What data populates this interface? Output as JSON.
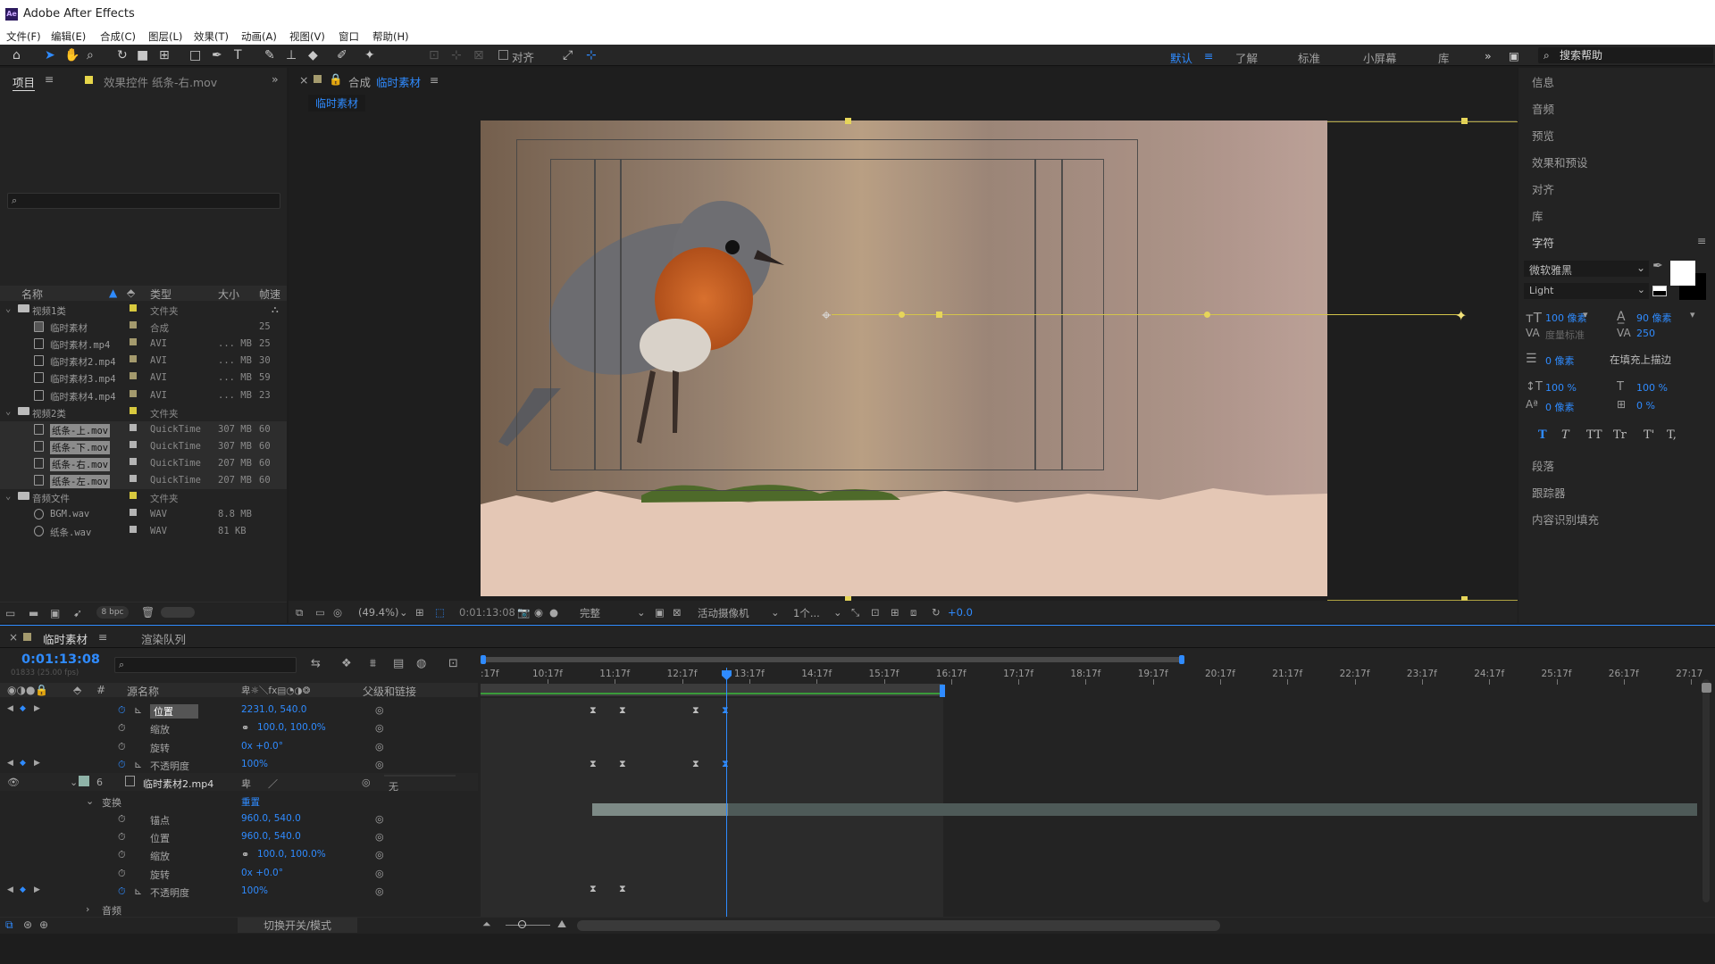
{
  "app": {
    "logo": "Ae",
    "title": "Adobe After Effects"
  },
  "menu": [
    "文件(F)",
    "编辑(E)",
    "合成(C)",
    "图层(L)",
    "效果(T)",
    "动画(A)",
    "视图(V)",
    "窗口",
    "帮助(H)"
  ],
  "toolbar": {
    "tools": [
      "home-icon",
      "selection-icon",
      "hand-icon",
      "zoom-icon",
      "rotate-icon",
      "camera-icon",
      "pan-behind-icon",
      "rectangle-icon",
      "pen-icon",
      "text-icon",
      "brush-icon",
      "clone-stamp-icon",
      "eraser-icon",
      "roto-brush-icon",
      "puppet-pin-icon"
    ],
    "align_label": "对齐",
    "workspaces": [
      "默认",
      "了解",
      "标准",
      "小屏幕",
      "库"
    ],
    "search_help": "搜索帮助"
  },
  "project": {
    "tab_project": "项目",
    "tab_effects": "效果控件 纸条-右.mov",
    "search_placeholder": "",
    "columns": {
      "name": "名称",
      "type": "类型",
      "size": "大小",
      "fps": "帧速"
    },
    "items": [
      {
        "name": "视频1类",
        "type": "文件夹",
        "size": "",
        "fps": "",
        "kind": "folder",
        "color": "#d8c93e",
        "indent": 0,
        "selected": false
      },
      {
        "name": "临时素材",
        "type": "合成",
        "size": "",
        "fps": "25",
        "kind": "comp",
        "color": "#a49a6d",
        "indent": 1,
        "selected": false
      },
      {
        "name": "临时素材.mp4",
        "type": "AVI",
        "size": "... MB",
        "fps": "25",
        "kind": "file",
        "color": "#a49a6d",
        "indent": 1,
        "selected": false
      },
      {
        "name": "临时素材2.mp4",
        "type": "AVI",
        "size": "... MB",
        "fps": "30",
        "kind": "file",
        "color": "#a49a6d",
        "indent": 1,
        "selected": false
      },
      {
        "name": "临时素材3.mp4",
        "type": "AVI",
        "size": "... MB",
        "fps": "59",
        "kind": "file",
        "color": "#a49a6d",
        "indent": 1,
        "selected": false
      },
      {
        "name": "临时素材4.mp4",
        "type": "AVI",
        "size": "... MB",
        "fps": "23",
        "kind": "file",
        "color": "#a49a6d",
        "indent": 1,
        "selected": false
      },
      {
        "name": "视频2类",
        "type": "文件夹",
        "size": "",
        "fps": "",
        "kind": "folder",
        "color": "#d8c93e",
        "indent": 0,
        "selected": false
      },
      {
        "name": "纸条-上.mov",
        "type": "QuickTime",
        "size": "307 MB",
        "fps": "60",
        "kind": "file",
        "color": "#b4b4b4",
        "indent": 1,
        "selected": true
      },
      {
        "name": "纸条-下.mov",
        "type": "QuickTime",
        "size": "307 MB",
        "fps": "60",
        "kind": "file",
        "color": "#b4b4b4",
        "indent": 1,
        "selected": true
      },
      {
        "name": "纸条-右.mov",
        "type": "QuickTime",
        "size": "207 MB",
        "fps": "60",
        "kind": "file",
        "color": "#b4b4b4",
        "indent": 1,
        "selected": true
      },
      {
        "name": "纸条-左.mov",
        "type": "QuickTime",
        "size": "207 MB",
        "fps": "60",
        "kind": "file",
        "color": "#b4b4b4",
        "indent": 1,
        "selected": true
      },
      {
        "name": "音频文件",
        "type": "文件夹",
        "size": "",
        "fps": "",
        "kind": "folder",
        "color": "#d8c93e",
        "indent": 0,
        "selected": false
      },
      {
        "name": "BGM.wav",
        "type": "WAV",
        "size": "8.8 MB",
        "fps": "",
        "kind": "audio",
        "color": "#b4b4b4",
        "indent": 1,
        "selected": false
      },
      {
        "name": "纸条.wav",
        "type": "WAV",
        "size": "81 KB",
        "fps": "",
        "kind": "audio",
        "color": "#b4b4b4",
        "indent": 1,
        "selected": false
      }
    ],
    "bpc": "8 bpc"
  },
  "composition": {
    "tab_prefix": "合成",
    "tab_name": "临时素材",
    "flow_tab": "临时素材",
    "zoom": "(49.4%)",
    "timecode": "0:01:13:08",
    "resolution": "完整",
    "camera": "活动摄像机",
    "views": "1个...",
    "exposure": "+0.0"
  },
  "right_panel": {
    "sections": [
      "信息",
      "音频",
      "预览",
      "效果和预设",
      "对齐",
      "库"
    ],
    "char_title": "字符",
    "font": "微软雅黑",
    "style": "Light",
    "size": "100 像素",
    "leading": "90 像素",
    "kerning": "度量标准",
    "tracking": "250",
    "stroke": "0 像素",
    "stroke_mode": "在填充上描边",
    "v_scale": "100 %",
    "h_scale": "100 %",
    "baseline": "0 像素",
    "tsume": "0 %",
    "format_buttons": [
      "T",
      "T",
      "TT",
      "Tr",
      "T'",
      "T,"
    ],
    "bottom_sections": [
      "段落",
      "跟踪器",
      "内容识别填充"
    ],
    "fill_color": "#ffffff",
    "stroke_color": "#000000"
  },
  "timeline": {
    "tab_comp": "临时素材",
    "tab_render": "渲染队列",
    "timecode": "0:01:13:08",
    "frames_info": "01833 (25.00 fps)",
    "col_source": "源名称",
    "col_parent": "父级和链接",
    "ruler": [
      "10:17f",
      "11:17f",
      "12:17f",
      "13:17f",
      "14:17f",
      "15:17f",
      "16:17f",
      "17:17f",
      "18:17f",
      "19:17f",
      "20:17f",
      "21:17f",
      "22:17f",
      "23:17f",
      "24:17f",
      "25:17f",
      "26:17f",
      "27:17"
    ],
    "ruler_start": ":17f",
    "rows": [
      {
        "name": "位置",
        "value": "2231.0, 540.0",
        "kind": "prop-kf",
        "highlight": true
      },
      {
        "name": "缩放",
        "value": "100.0, 100.0%",
        "kind": "prop-link"
      },
      {
        "name": "旋转",
        "value": "0x +0.0°",
        "kind": "prop"
      },
      {
        "name": "不透明度",
        "value": "100%",
        "kind": "prop-kf"
      },
      {
        "name": "临时素材2.mp4",
        "value": "",
        "kind": "layer",
        "number": "6",
        "parent": "无"
      },
      {
        "name": "变换",
        "value": "重置",
        "kind": "group"
      },
      {
        "name": "锚点",
        "value": "960.0, 540.0",
        "kind": "prop"
      },
      {
        "name": "位置",
        "value": "960.0, 540.0",
        "kind": "prop"
      },
      {
        "name": "缩放",
        "value": "100.0, 100.0%",
        "kind": "prop-link"
      },
      {
        "name": "旋转",
        "value": "0x +0.0°",
        "kind": "prop"
      },
      {
        "name": "不透明度",
        "value": "100%",
        "kind": "prop-kf"
      },
      {
        "name": "音频",
        "value": "",
        "kind": "group-collapsed"
      }
    ],
    "toggle_label": "切换开关/模式"
  },
  "colors": {
    "accent": "#2f8bff",
    "motion_path": "#d4c44a",
    "panel": "#232323"
  }
}
